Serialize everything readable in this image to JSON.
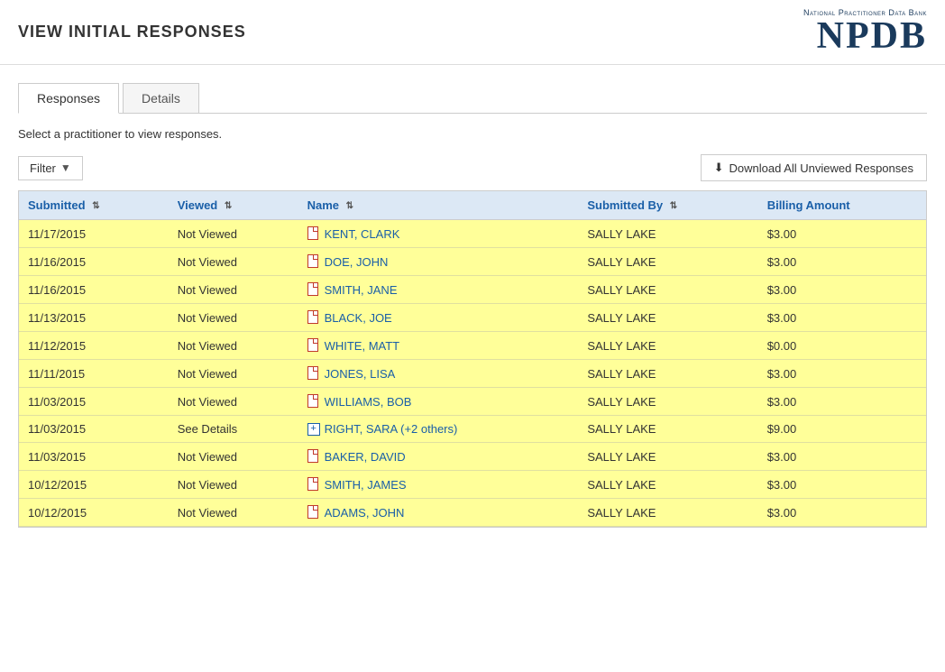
{
  "header": {
    "title": "View Initial Responses",
    "logo_small": "National Practitioner Data Bank",
    "logo_large": "NPDB"
  },
  "tabs": [
    {
      "id": "responses",
      "label": "Responses",
      "active": true
    },
    {
      "id": "details",
      "label": "Details",
      "active": false
    }
  ],
  "instruction": "Select a practitioner to view responses.",
  "toolbar": {
    "filter_label": "Filter",
    "download_label": "Download All Unviewed Responses"
  },
  "table": {
    "columns": [
      {
        "id": "submitted",
        "label": "Submitted"
      },
      {
        "id": "viewed",
        "label": "Viewed"
      },
      {
        "id": "name",
        "label": "Name"
      },
      {
        "id": "submitted_by",
        "label": "Submitted By"
      },
      {
        "id": "billing_amount",
        "label": "Billing Amount"
      }
    ],
    "rows": [
      {
        "submitted": "11/17/2015",
        "viewed": "Not Viewed",
        "name": "KENT, CLARK",
        "type": "doc",
        "submitted_by": "SALLY LAKE",
        "billing_amount": "$3.00"
      },
      {
        "submitted": "11/16/2015",
        "viewed": "Not Viewed",
        "name": "DOE, JOHN",
        "type": "doc",
        "submitted_by": "SALLY LAKE",
        "billing_amount": "$3.00"
      },
      {
        "submitted": "11/16/2015",
        "viewed": "Not Viewed",
        "name": "SMITH, JANE",
        "type": "doc",
        "submitted_by": "SALLY LAKE",
        "billing_amount": "$3.00"
      },
      {
        "submitted": "11/13/2015",
        "viewed": "Not Viewed",
        "name": "BLACK, JOE",
        "type": "doc",
        "submitted_by": "SALLY LAKE",
        "billing_amount": "$3.00"
      },
      {
        "submitted": "11/12/2015",
        "viewed": "Not Viewed",
        "name": "WHITE, MATT",
        "type": "doc",
        "submitted_by": "SALLY LAKE",
        "billing_amount": "$0.00"
      },
      {
        "submitted": "11/11/2015",
        "viewed": "Not Viewed",
        "name": "JONES, LISA",
        "type": "doc",
        "submitted_by": "SALLY LAKE",
        "billing_amount": "$3.00"
      },
      {
        "submitted": "11/03/2015",
        "viewed": "Not Viewed",
        "name": "WILLIAMS, BOB",
        "type": "doc",
        "submitted_by": "SALLY LAKE",
        "billing_amount": "$3.00"
      },
      {
        "submitted": "11/03/2015",
        "viewed": "See Details",
        "name": "RIGHT, SARA (+2 others)",
        "type": "expand",
        "submitted_by": "SALLY LAKE",
        "billing_amount": "$9.00"
      },
      {
        "submitted": "11/03/2015",
        "viewed": "Not Viewed",
        "name": "BAKER, DAVID",
        "type": "doc",
        "submitted_by": "SALLY LAKE",
        "billing_amount": "$3.00"
      },
      {
        "submitted": "10/12/2015",
        "viewed": "Not Viewed",
        "name": "SMITH, JAMES",
        "type": "doc",
        "submitted_by": "SALLY LAKE",
        "billing_amount": "$3.00"
      },
      {
        "submitted": "10/12/2015",
        "viewed": "Not Viewed",
        "name": "ADAMS, JOHN",
        "type": "doc",
        "submitted_by": "SALLY LAKE",
        "billing_amount": "$3.00"
      }
    ]
  }
}
